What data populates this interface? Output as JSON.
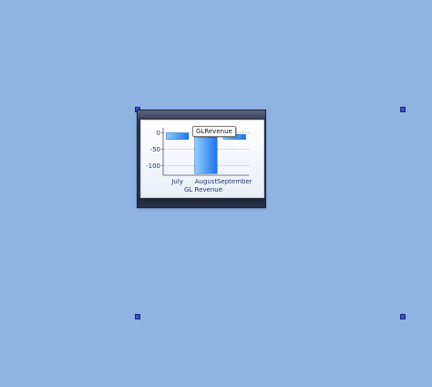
{
  "colors": {
    "bar_top": "#8fd0ff",
    "bar_bottom": "#1e73e8",
    "axis": "#555555",
    "text": "#1e3a6f"
  },
  "tooltip": {
    "text": "GLRevenue"
  },
  "chart_data": {
    "type": "bar",
    "title": "",
    "xlabel": "GL Revenue",
    "ylabel": "",
    "categories": [
      "July",
      "August",
      "September"
    ],
    "series": [
      {
        "name": "GLRevenue",
        "values": [
          -20,
          -125,
          -20
        ]
      }
    ],
    "bar_tops": [
      0,
      -5,
      -5
    ],
    "ylim": [
      -130,
      10
    ],
    "yticks": [
      0,
      -50,
      -100
    ],
    "grid": true,
    "legend": "none"
  }
}
